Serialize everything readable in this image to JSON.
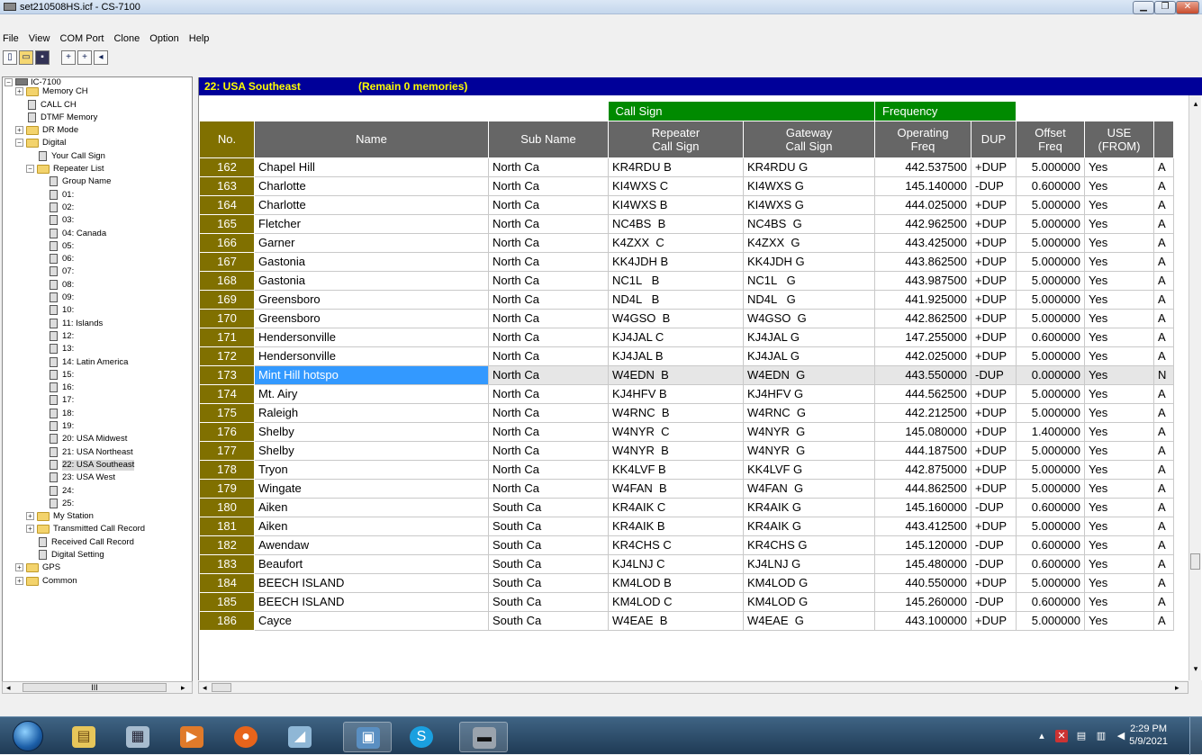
{
  "window": {
    "title": "set210508HS.icf - CS-7100",
    "min_icon": "minimize-icon",
    "max_icon": "restore-icon",
    "close_label": "✕"
  },
  "menu": [
    "File",
    "View",
    "COM Port",
    "Clone",
    "Option",
    "Help"
  ],
  "toolbar_icons": [
    "new-icon",
    "open-icon",
    "save-icon",
    "read-radio-icon",
    "write-radio-icon",
    "radio-info-icon"
  ],
  "tree": {
    "root": "IC-7100",
    "items": [
      {
        "label": "Memory CH",
        "type": "folder",
        "exp": "+"
      },
      {
        "label": "CALL CH",
        "type": "doc"
      },
      {
        "label": "DTMF Memory",
        "type": "doc"
      },
      {
        "label": "DR Mode",
        "type": "folder",
        "exp": "+"
      },
      {
        "label": "Digital",
        "type": "folder",
        "exp": "-"
      },
      {
        "label": "Your Call Sign",
        "type": "doc"
      },
      {
        "label": "Repeater List",
        "type": "folder",
        "exp": "-"
      },
      {
        "label": "Group Name",
        "type": "doc"
      },
      {
        "label": "01:",
        "type": "doc"
      },
      {
        "label": "02:",
        "type": "doc"
      },
      {
        "label": "03:",
        "type": "doc"
      },
      {
        "label": "04: Canada",
        "type": "doc"
      },
      {
        "label": "05:",
        "type": "doc"
      },
      {
        "label": "06:",
        "type": "doc"
      },
      {
        "label": "07:",
        "type": "doc"
      },
      {
        "label": "08:",
        "type": "doc"
      },
      {
        "label": "09:",
        "type": "doc"
      },
      {
        "label": "10:",
        "type": "doc"
      },
      {
        "label": "11: Islands",
        "type": "doc"
      },
      {
        "label": "12:",
        "type": "doc"
      },
      {
        "label": "13:",
        "type": "doc"
      },
      {
        "label": "14: Latin America",
        "type": "doc"
      },
      {
        "label": "15:",
        "type": "doc"
      },
      {
        "label": "16:",
        "type": "doc"
      },
      {
        "label": "17:",
        "type": "doc"
      },
      {
        "label": "18:",
        "type": "doc"
      },
      {
        "label": "19:",
        "type": "doc"
      },
      {
        "label": "20: USA Midwest",
        "type": "doc"
      },
      {
        "label": "21: USA Northeast",
        "type": "doc"
      },
      {
        "label": "22: USA Southeast",
        "type": "doc",
        "selected": true
      },
      {
        "label": "23: USA West",
        "type": "doc"
      },
      {
        "label": "24:",
        "type": "doc"
      },
      {
        "label": "25:",
        "type": "doc"
      },
      {
        "label": "My Station",
        "type": "folder",
        "exp": "+"
      },
      {
        "label": "Transmitted Call Record",
        "type": "folder",
        "exp": "+"
      },
      {
        "label": "Received Call Record",
        "type": "doc"
      },
      {
        "label": "Digital Setting",
        "type": "doc"
      },
      {
        "label": "GPS",
        "type": "folder",
        "exp": "+"
      },
      {
        "label": "Common",
        "type": "folder",
        "exp": "+"
      }
    ],
    "scroll_thumb": "III"
  },
  "grid": {
    "group_title": "22: USA Southeast",
    "remain_text": "(Remain  0 memories)",
    "group_headers": {
      "call_sign": "Call Sign",
      "frequency": "Frequency"
    },
    "columns": {
      "no": "No.",
      "name": "Name",
      "sub_name": "Sub Name",
      "repeater": [
        "Repeater",
        "Call Sign"
      ],
      "gateway": [
        "Gateway",
        "Call Sign"
      ],
      "operating": [
        "Operating",
        "Freq"
      ],
      "dup": "DUP",
      "offset": [
        "Offset",
        "Freq"
      ],
      "use": [
        "USE",
        "(FROM)"
      ]
    },
    "rows": [
      {
        "no": "162",
        "name": "Chapel Hill",
        "sub": "North Ca",
        "rpt": "KR4RDU B",
        "gw": "KR4RDU G",
        "freq": "442.537500",
        "dup": "+DUP",
        "off": "5.000000",
        "use": "Yes",
        "x": "A"
      },
      {
        "no": "163",
        "name": "Charlotte",
        "sub": "North Ca",
        "rpt": "KI4WXS C",
        "gw": "KI4WXS G",
        "freq": "145.140000",
        "dup": "-DUP",
        "off": "0.600000",
        "use": "Yes",
        "x": "A"
      },
      {
        "no": "164",
        "name": "Charlotte",
        "sub": "North Ca",
        "rpt": "KI4WXS B",
        "gw": "KI4WXS G",
        "freq": "444.025000",
        "dup": "+DUP",
        "off": "5.000000",
        "use": "Yes",
        "x": "A"
      },
      {
        "no": "165",
        "name": "Fletcher",
        "sub": "North Ca",
        "rpt": "NC4BS  B",
        "gw": "NC4BS  G",
        "freq": "442.962500",
        "dup": "+DUP",
        "off": "5.000000",
        "use": "Yes",
        "x": "A"
      },
      {
        "no": "166",
        "name": "Garner",
        "sub": "North Ca",
        "rpt": "K4ZXX  C",
        "gw": "K4ZXX  G",
        "freq": "443.425000",
        "dup": "+DUP",
        "off": "5.000000",
        "use": "Yes",
        "x": "A"
      },
      {
        "no": "167",
        "name": "Gastonia",
        "sub": "North Ca",
        "rpt": "KK4JDH B",
        "gw": "KK4JDH G",
        "freq": "443.862500",
        "dup": "+DUP",
        "off": "5.000000",
        "use": "Yes",
        "x": "A"
      },
      {
        "no": "168",
        "name": "Gastonia",
        "sub": "North Ca",
        "rpt": "NC1L   B",
        "gw": "NC1L   G",
        "freq": "443.987500",
        "dup": "+DUP",
        "off": "5.000000",
        "use": "Yes",
        "x": "A"
      },
      {
        "no": "169",
        "name": "Greensboro",
        "sub": "North Ca",
        "rpt": "ND4L   B",
        "gw": "ND4L   G",
        "freq": "441.925000",
        "dup": "+DUP",
        "off": "5.000000",
        "use": "Yes",
        "x": "A"
      },
      {
        "no": "170",
        "name": "Greensboro",
        "sub": "North Ca",
        "rpt": "W4GSO  B",
        "gw": "W4GSO  G",
        "freq": "442.862500",
        "dup": "+DUP",
        "off": "5.000000",
        "use": "Yes",
        "x": "A"
      },
      {
        "no": "171",
        "name": "Hendersonville",
        "sub": "North Ca",
        "rpt": "KJ4JAL C",
        "gw": "KJ4JAL G",
        "freq": "147.255000",
        "dup": "+DUP",
        "off": "0.600000",
        "use": "Yes",
        "x": "A"
      },
      {
        "no": "172",
        "name": "Hendersonville",
        "sub": "North Ca",
        "rpt": "KJ4JAL B",
        "gw": "KJ4JAL G",
        "freq": "442.025000",
        "dup": "+DUP",
        "off": "5.000000",
        "use": "Yes",
        "x": "A"
      },
      {
        "no": "173",
        "name": "Mint Hill hotspo",
        "sub": "North Ca",
        "rpt": "W4EDN  B",
        "gw": "W4EDN  G",
        "freq": "443.550000",
        "dup": "-DUP",
        "off": "0.000000",
        "use": "Yes",
        "x": "N",
        "selected": true
      },
      {
        "no": "174",
        "name": "Mt. Airy",
        "sub": "North Ca",
        "rpt": "KJ4HFV B",
        "gw": "KJ4HFV G",
        "freq": "444.562500",
        "dup": "+DUP",
        "off": "5.000000",
        "use": "Yes",
        "x": "A"
      },
      {
        "no": "175",
        "name": "Raleigh",
        "sub": "North Ca",
        "rpt": "W4RNC  B",
        "gw": "W4RNC  G",
        "freq": "442.212500",
        "dup": "+DUP",
        "off": "5.000000",
        "use": "Yes",
        "x": "A"
      },
      {
        "no": "176",
        "name": "Shelby",
        "sub": "North Ca",
        "rpt": "W4NYR  C",
        "gw": "W4NYR  G",
        "freq": "145.080000",
        "dup": "+DUP",
        "off": "1.400000",
        "use": "Yes",
        "x": "A"
      },
      {
        "no": "177",
        "name": "Shelby",
        "sub": "North Ca",
        "rpt": "W4NYR  B",
        "gw": "W4NYR  G",
        "freq": "444.187500",
        "dup": "+DUP",
        "off": "5.000000",
        "use": "Yes",
        "x": "A"
      },
      {
        "no": "178",
        "name": "Tryon",
        "sub": "North Ca",
        "rpt": "KK4LVF B",
        "gw": "KK4LVF G",
        "freq": "442.875000",
        "dup": "+DUP",
        "off": "5.000000",
        "use": "Yes",
        "x": "A"
      },
      {
        "no": "179",
        "name": "Wingate",
        "sub": "North Ca",
        "rpt": "W4FAN  B",
        "gw": "W4FAN  G",
        "freq": "444.862500",
        "dup": "+DUP",
        "off": "5.000000",
        "use": "Yes",
        "x": "A"
      },
      {
        "no": "180",
        "name": "Aiken",
        "sub": "South Ca",
        "rpt": "KR4AIK C",
        "gw": "KR4AIK G",
        "freq": "145.160000",
        "dup": "-DUP",
        "off": "0.600000",
        "use": "Yes",
        "x": "A"
      },
      {
        "no": "181",
        "name": "Aiken",
        "sub": "South Ca",
        "rpt": "KR4AIK B",
        "gw": "KR4AIK G",
        "freq": "443.412500",
        "dup": "+DUP",
        "off": "5.000000",
        "use": "Yes",
        "x": "A"
      },
      {
        "no": "182",
        "name": "Awendaw",
        "sub": "South Ca",
        "rpt": "KR4CHS C",
        "gw": "KR4CHS G",
        "freq": "145.120000",
        "dup": "-DUP",
        "off": "0.600000",
        "use": "Yes",
        "x": "A"
      },
      {
        "no": "183",
        "name": "Beaufort",
        "sub": "South Ca",
        "rpt": "KJ4LNJ C",
        "gw": "KJ4LNJ G",
        "freq": "145.480000",
        "dup": "-DUP",
        "off": "0.600000",
        "use": "Yes",
        "x": "A"
      },
      {
        "no": "184",
        "name": "BEECH ISLAND",
        "sub": "South Ca",
        "rpt": "KM4LOD B",
        "gw": "KM4LOD G",
        "freq": "440.550000",
        "dup": "+DUP",
        "off": "5.000000",
        "use": "Yes",
        "x": "A"
      },
      {
        "no": "185",
        "name": "BEECH ISLAND",
        "sub": "South Ca",
        "rpt": "KM4LOD C",
        "gw": "KM4LOD G",
        "freq": "145.260000",
        "dup": "-DUP",
        "off": "0.600000",
        "use": "Yes",
        "x": "A"
      },
      {
        "no": "186",
        "name": "Cayce",
        "sub": "South Ca",
        "rpt": "W4EAE  B",
        "gw": "W4EAE  G",
        "freq": "443.100000",
        "dup": "+DUP",
        "off": "5.000000",
        "use": "Yes",
        "x": "A"
      }
    ]
  },
  "taskbar": {
    "apps": [
      "explorer-icon",
      "calculator-icon",
      "media-player-icon",
      "firefox-icon",
      "notepad-icon",
      "control-panel-icon",
      "skype-icon",
      "cs7100-icon"
    ],
    "clock_time": "2:29 PM",
    "clock_date": "5/9/2021",
    "tray_icons": [
      "show-hidden-icon",
      "network-flag-icon",
      "printer-icon",
      "network-icon",
      "volume-icon"
    ]
  }
}
